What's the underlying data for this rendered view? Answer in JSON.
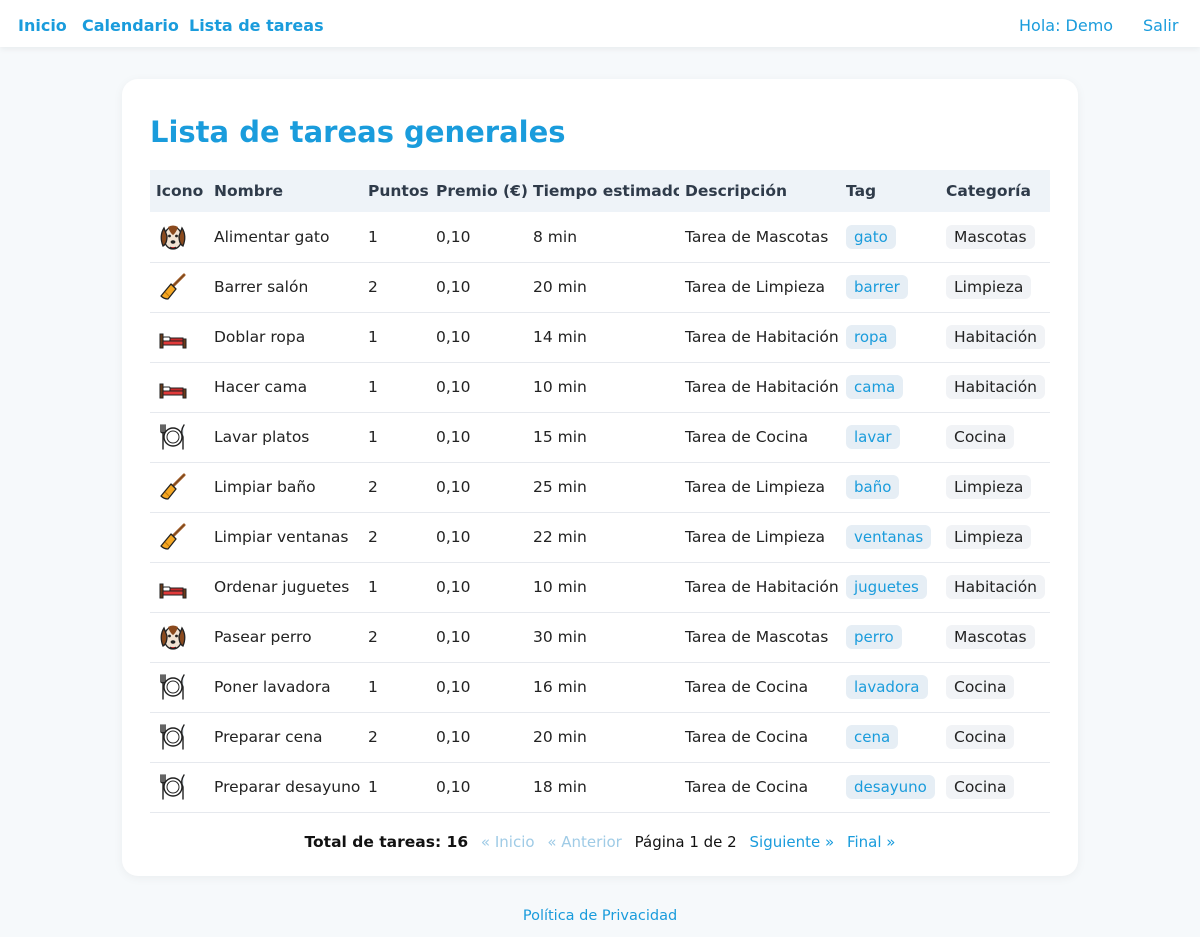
{
  "nav": {
    "links": [
      "Inicio",
      "Calendario",
      "Lista de tareas"
    ],
    "greeting": "Hola: Demo",
    "logout": "Salir"
  },
  "page": {
    "title": "Lista de tareas generales"
  },
  "table": {
    "headers": [
      "Icono",
      "Nombre",
      "Puntos",
      "Premio (€)",
      "Tiempo estimado",
      "Descripción",
      "Tag",
      "Categoría"
    ],
    "rows": [
      {
        "icon": "dog-icon",
        "name": "Alimentar gato",
        "points": "1",
        "prize": "0,10",
        "time": "8 min",
        "desc": "Tarea de Mascotas",
        "tag": "gato",
        "category": "Mascotas"
      },
      {
        "icon": "broom-icon",
        "name": "Barrer salón",
        "points": "2",
        "prize": "0,10",
        "time": "20 min",
        "desc": "Tarea de Limpieza",
        "tag": "barrer",
        "category": "Limpieza"
      },
      {
        "icon": "bed-icon",
        "name": "Doblar ropa",
        "points": "1",
        "prize": "0,10",
        "time": "14 min",
        "desc": "Tarea de Habitación",
        "tag": "ropa",
        "category": "Habitación"
      },
      {
        "icon": "bed-icon",
        "name": "Hacer cama",
        "points": "1",
        "prize": "0,10",
        "time": "10 min",
        "desc": "Tarea de Habitación",
        "tag": "cama",
        "category": "Habitación"
      },
      {
        "icon": "plate-cutlery-icon",
        "name": "Lavar platos",
        "points": "1",
        "prize": "0,10",
        "time": "15 min",
        "desc": "Tarea de Cocina",
        "tag": "lavar",
        "category": "Cocina"
      },
      {
        "icon": "broom-icon",
        "name": "Limpiar baño",
        "points": "2",
        "prize": "0,10",
        "time": "25 min",
        "desc": "Tarea de Limpieza",
        "tag": "baño",
        "category": "Limpieza"
      },
      {
        "icon": "broom-icon",
        "name": "Limpiar ventanas",
        "points": "2",
        "prize": "0,10",
        "time": "22 min",
        "desc": "Tarea de Limpieza",
        "tag": "ventanas",
        "category": "Limpieza"
      },
      {
        "icon": "bed-icon",
        "name": "Ordenar juguetes",
        "points": "1",
        "prize": "0,10",
        "time": "10 min",
        "desc": "Tarea de Habitación",
        "tag": "juguetes",
        "category": "Habitación"
      },
      {
        "icon": "dog-icon",
        "name": "Pasear perro",
        "points": "2",
        "prize": "0,10",
        "time": "30 min",
        "desc": "Tarea de Mascotas",
        "tag": "perro",
        "category": "Mascotas"
      },
      {
        "icon": "plate-cutlery-icon",
        "name": "Poner lavadora",
        "points": "1",
        "prize": "0,10",
        "time": "16 min",
        "desc": "Tarea de Cocina",
        "tag": "lavadora",
        "category": "Cocina"
      },
      {
        "icon": "plate-cutlery-icon",
        "name": "Preparar cena",
        "points": "2",
        "prize": "0,10",
        "time": "20 min",
        "desc": "Tarea de Cocina",
        "tag": "cena",
        "category": "Cocina"
      },
      {
        "icon": "plate-cutlery-icon",
        "name": "Preparar desayuno",
        "points": "1",
        "prize": "0,10",
        "time": "18 min",
        "desc": "Tarea de Cocina",
        "tag": "desayuno",
        "category": "Cocina"
      }
    ]
  },
  "pagination": {
    "total_label": "Total de tareas: 16",
    "first": "« Inicio",
    "prev": "« Anterior",
    "current": "Página 1 de 2",
    "next": "Siguiente »",
    "last": "Final »"
  },
  "footer": {
    "privacy": "Política de Privacidad"
  },
  "colors": {
    "accent": "#1a9cdc",
    "background": "#f6f9fb",
    "tag_bg": "#e6eef5",
    "category_bg": "#f1f3f6"
  }
}
